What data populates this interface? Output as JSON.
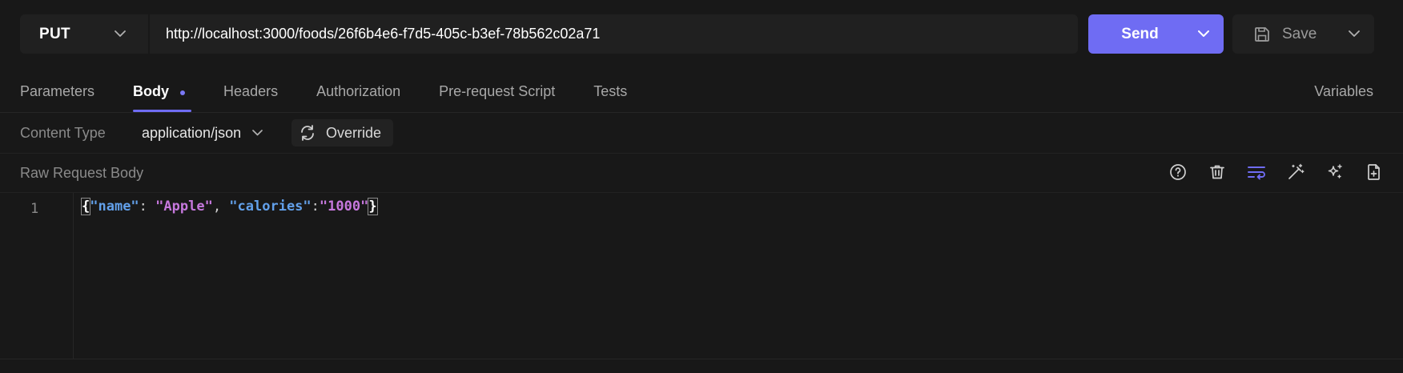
{
  "request": {
    "method": "PUT",
    "url": "http://localhost:3000/foods/26f6b4e6-f7d5-405c-b3ef-78b562c02a71",
    "send_label": "Send",
    "save_label": "Save"
  },
  "tabs": [
    {
      "label": "Parameters",
      "active": false
    },
    {
      "label": "Body",
      "active": true,
      "modified": true
    },
    {
      "label": "Headers",
      "active": false
    },
    {
      "label": "Authorization",
      "active": false
    },
    {
      "label": "Pre-request Script",
      "active": false
    },
    {
      "label": "Tests",
      "active": false
    }
  ],
  "variables_label": "Variables",
  "content_type": {
    "label": "Content Type",
    "value": "application/json",
    "override_label": "Override"
  },
  "raw_body": {
    "label": "Raw Request Body",
    "toolbar_icons": [
      "help-icon",
      "trash-icon",
      "wrap-lines-icon",
      "magic-wand-icon",
      "sparkles-icon",
      "add-file-icon"
    ],
    "line_number": "1",
    "tokens": {
      "open_brace": "{",
      "key_name": "\"name\"",
      "colon1": ": ",
      "val_name": "\"Apple\"",
      "comma": ", ",
      "key_calories": "\"calories\"",
      "colon2": ":",
      "val_calories": "\"1000\"",
      "close_brace": "}"
    }
  },
  "colors": {
    "accent": "#6f6cf3",
    "background": "#181818",
    "json_key": "#62a0ea",
    "json_string": "#c678dd"
  }
}
